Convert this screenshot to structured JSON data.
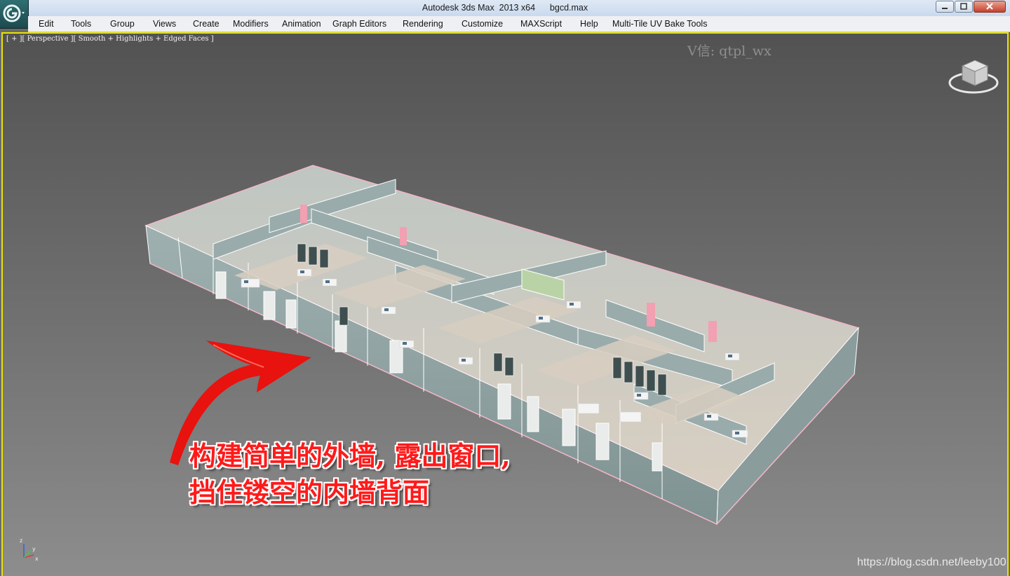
{
  "window": {
    "title": "Autodesk 3ds Max  2013 x64      bgcd.max"
  },
  "menu": {
    "items": [
      "Edit",
      "Tools",
      "Group",
      "Views",
      "Create",
      "Modifiers",
      "Animation",
      "Graph Editors",
      "Rendering",
      "Customize",
      "MAXScript",
      "Help",
      "Multi-Tile UV Bake Tools"
    ]
  },
  "viewport": {
    "label": "[ + ][ Perspective ][ Smooth + Highlights + Edged Faces ]",
    "watermark": "V信: qtpl_wx",
    "caption_line1": "构建简单的外墙, 露出窗口,",
    "caption_line2": "挡住镂空的内墙背面",
    "credit": "https://blog.csdn.net/leeby100",
    "axis_labels": {
      "z": "z",
      "y": "y",
      "x": "x"
    }
  },
  "icons": [
    "app-logo-icon",
    "minimize-icon",
    "maximize-icon",
    "close-icon",
    "viewcube-icon",
    "axis-tripod-icon",
    "red-arrow-icon"
  ],
  "colors": {
    "viewport_border": "#e8e400",
    "caption": "#ff1a1a",
    "wall": "#8fa3a3",
    "floor": "#cfc6b8"
  }
}
